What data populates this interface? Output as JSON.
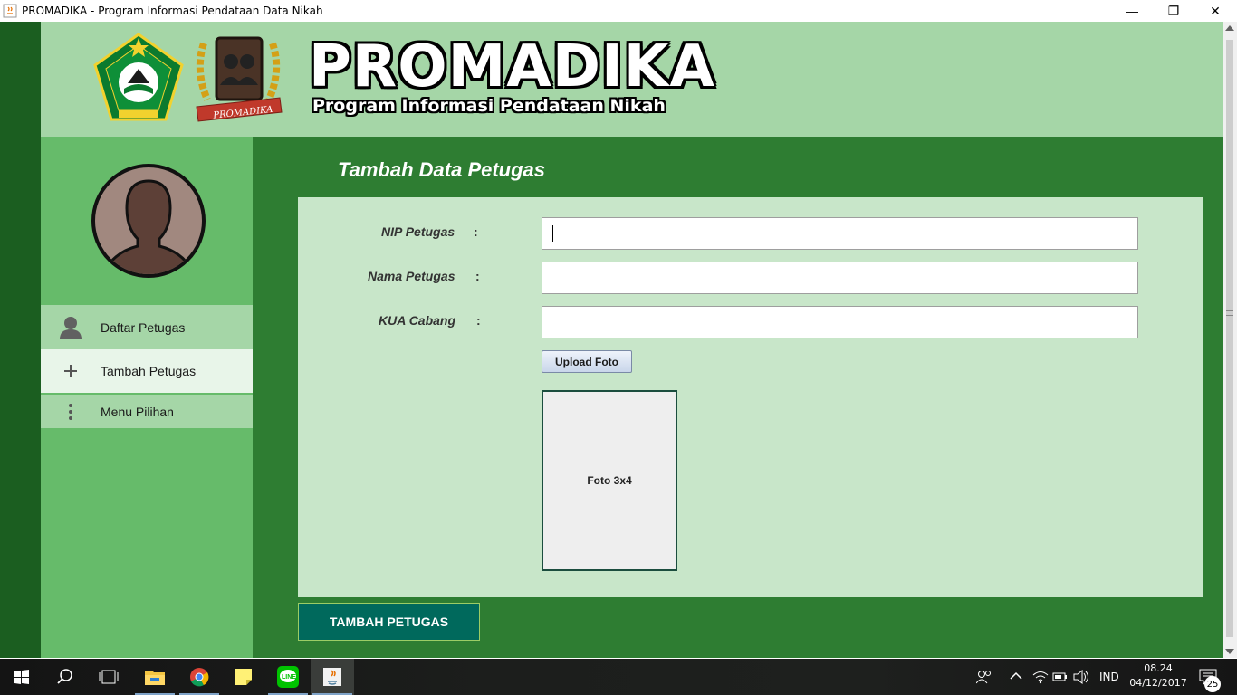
{
  "window": {
    "title": "PROMADIKA - Program Informasi Pendataan Data Nikah",
    "minimize": "—",
    "maximize": "❐",
    "close": "✕"
  },
  "header": {
    "brand": "PROMADIKA",
    "subtitle": "Program Informasi Pendataan Nikah",
    "logos": [
      "kemenag-logo",
      "promadika-logo"
    ]
  },
  "sidebar": {
    "items": [
      {
        "label": "Daftar Petugas",
        "icon": "person-icon",
        "active": false
      },
      {
        "label": "Tambah Petugas",
        "icon": "plus-icon",
        "active": true
      },
      {
        "label": "Menu Pilihan",
        "icon": "more-vertical-icon",
        "active": false
      }
    ]
  },
  "main": {
    "title": "Tambah Data Petugas",
    "fields": [
      {
        "label": "NIP Petugas",
        "colon": ":",
        "value": ""
      },
      {
        "label": "Nama Petugas",
        "colon": ":",
        "value": ""
      },
      {
        "label": "KUA Cabang",
        "colon": ":",
        "value": ""
      }
    ],
    "upload_label": "Upload Foto",
    "photo_placeholder": "Foto 3x4",
    "submit_label": "TAMBAH PETUGAS"
  },
  "taskbar": {
    "apps": [
      "file-explorer-icon",
      "chrome-icon",
      "sticky-notes-icon",
      "line-icon",
      "java-icon"
    ],
    "language": "IND",
    "time": "08.24",
    "date": "04/12/2017",
    "notifications": "25"
  },
  "colors": {
    "header_bg": "#a5d6a7",
    "sidebar_bg": "#66bb6a",
    "main_bg": "#2e7d32",
    "form_bg": "#c8e6c9",
    "submit_bg": "#00695c"
  }
}
